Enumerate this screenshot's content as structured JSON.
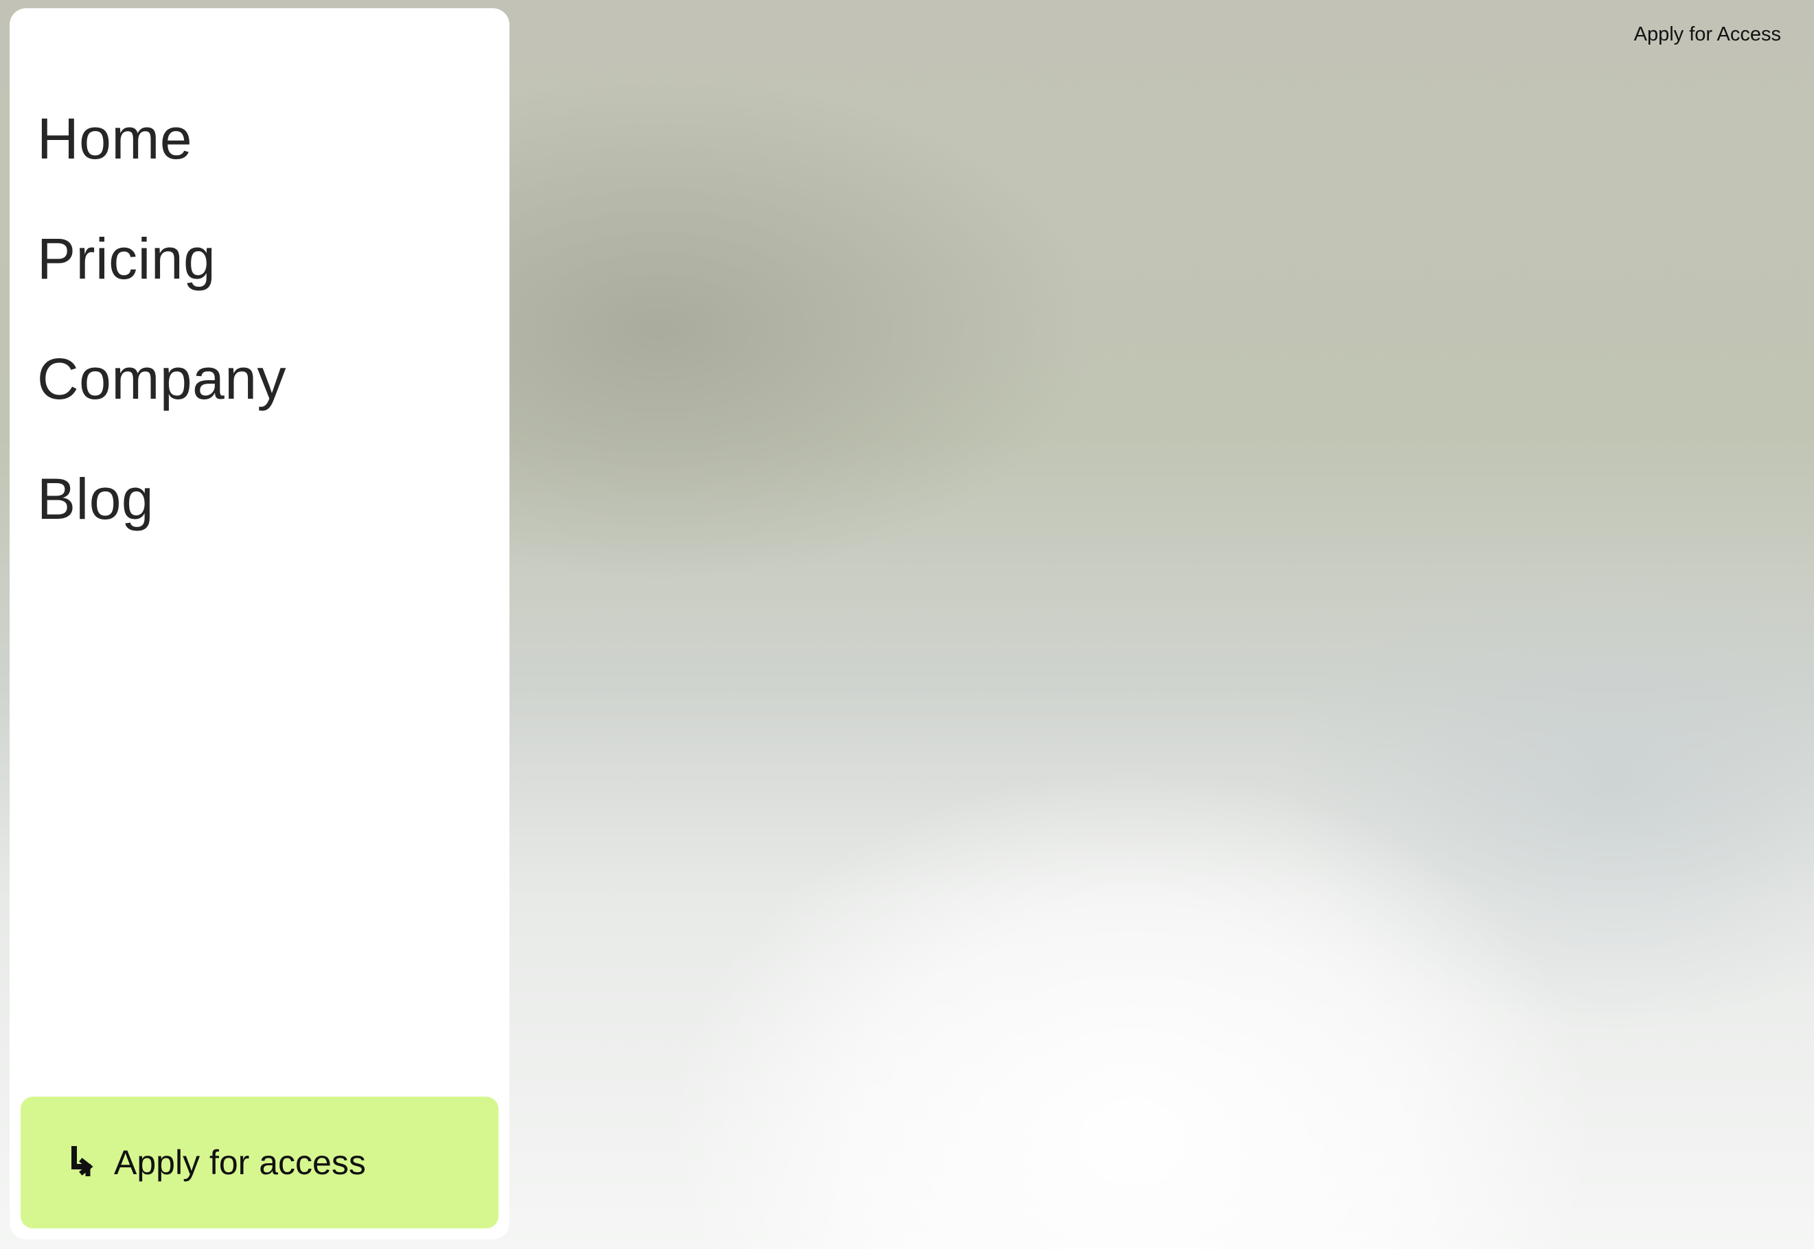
{
  "nav": {
    "items": [
      {
        "label": "Home"
      },
      {
        "label": "Pricing"
      },
      {
        "label": "Company"
      },
      {
        "label": "Blog"
      }
    ]
  },
  "cta": {
    "icon": "arrow-down-right-icon",
    "label": "Apply for access",
    "background_color": "#d6f78f"
  },
  "header": {
    "apply_link_label": "Apply for Access"
  }
}
